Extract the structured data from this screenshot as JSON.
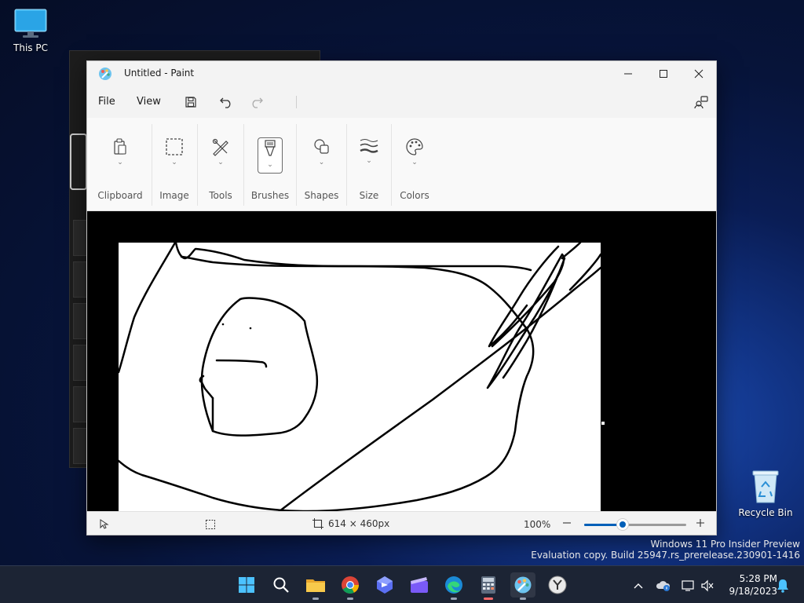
{
  "desktop": {
    "this_pc_label": "This PC",
    "recycle_bin_label": "Recycle Bin",
    "watermark_line1": "Windows 11 Pro Insider Preview",
    "watermark_line2": "Evaluation copy. Build 25947.rs_prerelease.230901-1416"
  },
  "paint": {
    "title": "Untitled - Paint",
    "menu": {
      "file": "File",
      "view": "View"
    },
    "ribbon": {
      "groups": [
        {
          "label": "Clipboard",
          "icon": "clipboard-icon"
        },
        {
          "label": "Image",
          "icon": "selection-icon"
        },
        {
          "label": "Tools",
          "icon": "tools-icon"
        },
        {
          "label": "Brushes",
          "icon": "brush-icon",
          "selected": true
        },
        {
          "label": "Shapes",
          "icon": "shapes-icon"
        },
        {
          "label": "Size",
          "icon": "size-icon"
        },
        {
          "label": "Colors",
          "icon": "palette-icon"
        }
      ]
    },
    "status": {
      "canvas_size": "614 × 460px",
      "zoom": "100%",
      "zoom_level": 0.38
    }
  },
  "taskbar": {
    "apps": [
      "start-icon",
      "search-icon",
      "file-explorer-icon",
      "chrome-icon",
      "app-icon",
      "clipchamp-icon",
      "edge-icon",
      "calculator-icon",
      "paint-icon",
      "clock-app-icon"
    ],
    "time": "5:28 PM",
    "date": "9/18/2023"
  },
  "colors": {
    "accent": "#005fb8",
    "taskbar": "#1c2434"
  }
}
